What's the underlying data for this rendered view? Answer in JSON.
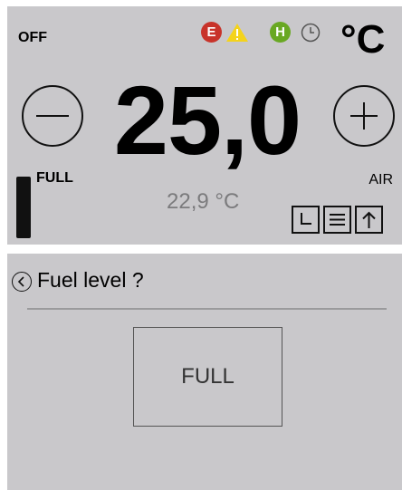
{
  "status": {
    "power_state": "OFF",
    "error_badge": "E",
    "warning_icon": "warning-triangle-icon",
    "heater_badge": "H",
    "timer_icon": "clock-icon",
    "unit": "°C"
  },
  "thermostat": {
    "setpoint": "25,0",
    "current_temp": "22,9 °C",
    "fuel_label": "FULL",
    "mode_label": "AIR",
    "minus_icon": "minus-icon",
    "plus_icon": "plus-icon",
    "toolbar_icons": [
      "timer-icon",
      "menu-icon",
      "arrow-up-icon"
    ]
  },
  "dialog": {
    "title": "Fuel level ?",
    "back_icon": "chevron-left-icon",
    "option": "FULL"
  },
  "colors": {
    "panel_bg": "#c9c8cb",
    "error_red": "#c8332a",
    "warning_yellow": "#f4d31c",
    "heater_green": "#69a823",
    "secondary_text": "#7b7b7d"
  }
}
